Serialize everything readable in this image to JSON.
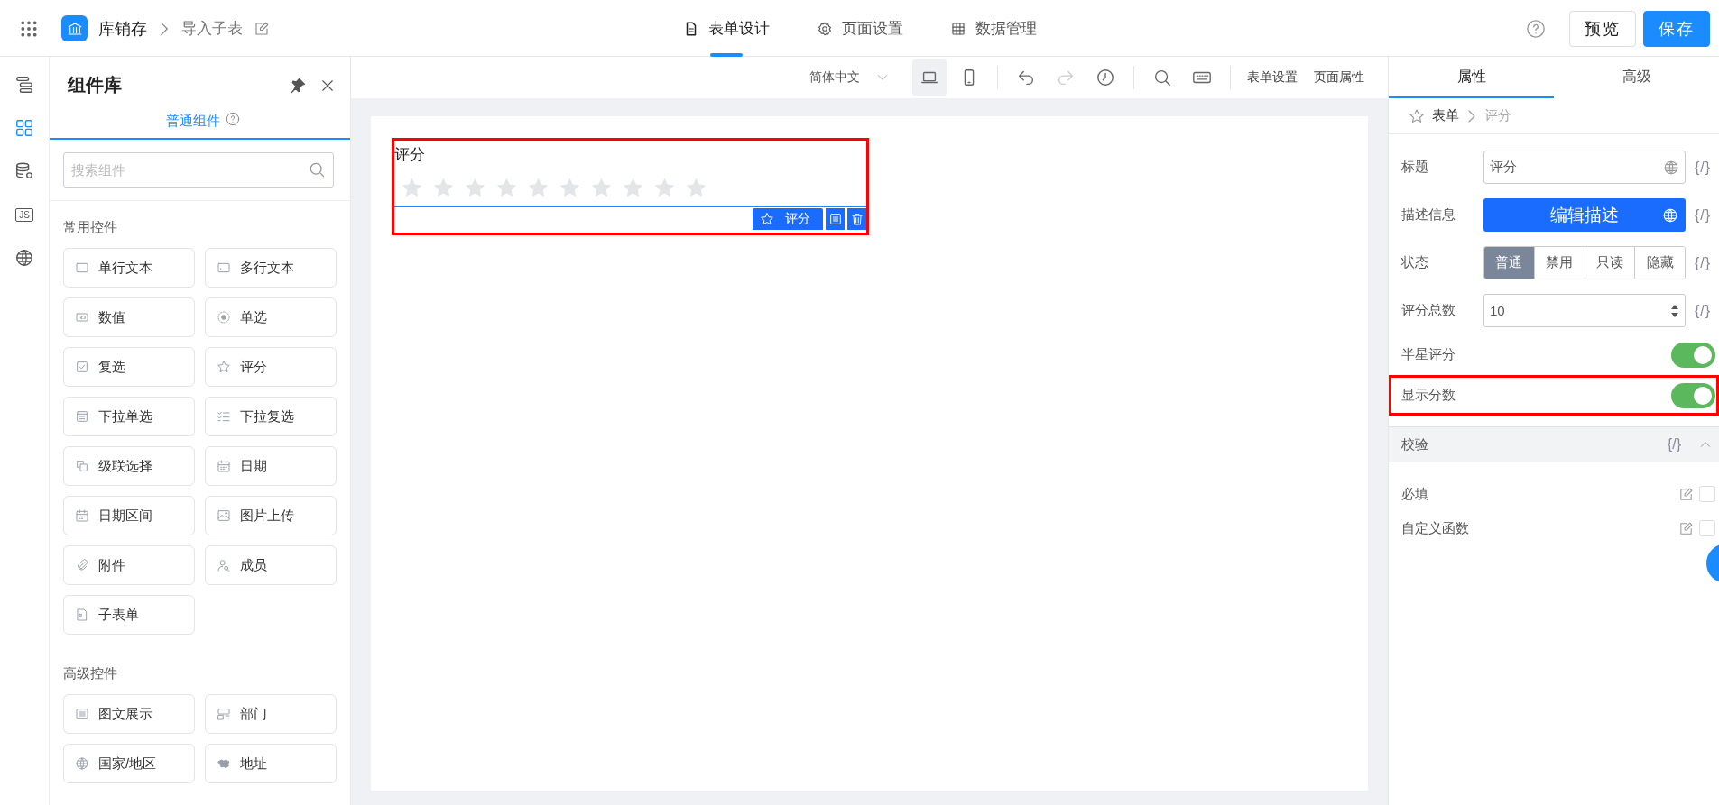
{
  "top_bar": {
    "app_name": "库销存",
    "breadcrumb": "导入子表",
    "tabs": [
      {
        "label": "表单设计",
        "kind": "form",
        "selected": true
      },
      {
        "label": "页面设置",
        "kind": "gear",
        "selected": false
      },
      {
        "label": "数据管理",
        "kind": "table",
        "selected": false
      }
    ],
    "buttons": [
      {
        "label": "预览",
        "kind": "secondary"
      },
      {
        "label": "保存",
        "kind": "primary"
      }
    ]
  },
  "rail": {
    "items": [
      {
        "kind": "outline",
        "selected": false
      },
      {
        "kind": "components",
        "selected": true
      },
      {
        "kind": "database",
        "selected": false
      },
      {
        "kind": "js",
        "label": "JS",
        "selected": false
      },
      {
        "kind": "globe",
        "selected": false
      }
    ]
  },
  "component_panel": {
    "title": "组件库",
    "tab": "普通组件",
    "search_placeholder": "搜索组件",
    "groups": [
      {
        "title": "常用控件",
        "items": [
          {
            "label": "单行文本",
            "kind": "textline"
          },
          {
            "label": "多行文本",
            "kind": "textline"
          },
          {
            "label": "数值",
            "kind": "number"
          },
          {
            "label": "单选",
            "kind": "radio"
          },
          {
            "label": "复选",
            "kind": "checkbox"
          },
          {
            "label": "评分",
            "kind": "star"
          },
          {
            "label": "下拉单选",
            "kind": "dropdown"
          },
          {
            "label": "下拉复选",
            "kind": "checklist"
          },
          {
            "label": "级联选择",
            "kind": "cascade"
          },
          {
            "label": "日期",
            "kind": "calendar"
          },
          {
            "label": "日期区间",
            "kind": "calendar"
          },
          {
            "label": "图片上传",
            "kind": "image"
          },
          {
            "label": "附件",
            "kind": "clip"
          },
          {
            "label": "成员",
            "kind": "user"
          },
          {
            "label": "子表单",
            "kind": "doc"
          }
        ]
      },
      {
        "title": "高级控件",
        "items": [
          {
            "label": "图文展示",
            "kind": "lines"
          },
          {
            "label": "部门",
            "kind": "dept"
          },
          {
            "label": "国家/地区",
            "kind": "globe"
          },
          {
            "label": "地址",
            "kind": "map"
          }
        ]
      }
    ]
  },
  "canvas_toolbar": {
    "language": "简体中文",
    "tools": [
      {
        "kind": "desktop",
        "selected": true,
        "disabled": false
      },
      {
        "kind": "mobile",
        "selected": false,
        "disabled": false
      },
      {
        "kind": "undo",
        "selected": false,
        "disabled": false
      },
      {
        "kind": "redo",
        "selected": false,
        "disabled": true
      },
      {
        "kind": "history",
        "selected": false,
        "disabled": false
      },
      {
        "kind": "search",
        "selected": false,
        "disabled": false
      },
      {
        "kind": "keyboard",
        "selected": false,
        "disabled": false
      }
    ],
    "links": [
      "表单设置",
      "页面属性"
    ]
  },
  "form": {
    "fields": [
      {
        "kind": "rating",
        "label": "评分",
        "stars": 0,
        "selected": true,
        "tag": "评分"
      }
    ]
  },
  "properties": {
    "tabs": [
      {
        "label": "属性",
        "selected": true
      },
      {
        "label": "高级",
        "selected": false
      }
    ],
    "breadcrumb": [
      "表单",
      "评分"
    ],
    "rows": [
      {
        "kind": "text",
        "label": "标题",
        "value": "评分",
        "binding": "{/}"
      },
      {
        "kind": "button",
        "label": "描述信息",
        "value": "编辑描述",
        "binding": "{/}"
      },
      {
        "kind": "segmented",
        "label": "状态",
        "binding": "{/}",
        "options": [
          {
            "label": "普通",
            "selected": true
          },
          {
            "label": "禁用",
            "selected": false
          },
          {
            "label": "只读",
            "selected": false
          },
          {
            "label": "隐藏",
            "selected": false
          }
        ]
      },
      {
        "kind": "number",
        "label": "评分总数",
        "value": "10",
        "binding": "{/}"
      },
      {
        "kind": "toggle",
        "label": "半星评分",
        "on": true,
        "highlighted": false
      },
      {
        "kind": "toggle",
        "label": "显示分数",
        "on": true,
        "highlighted": true
      }
    ],
    "validation": {
      "title": "校验",
      "binding": "{/}",
      "expanded": true,
      "rules": [
        {
          "label": "必填",
          "checked": false
        },
        {
          "label": "自定义函数",
          "checked": false
        }
      ]
    }
  }
}
